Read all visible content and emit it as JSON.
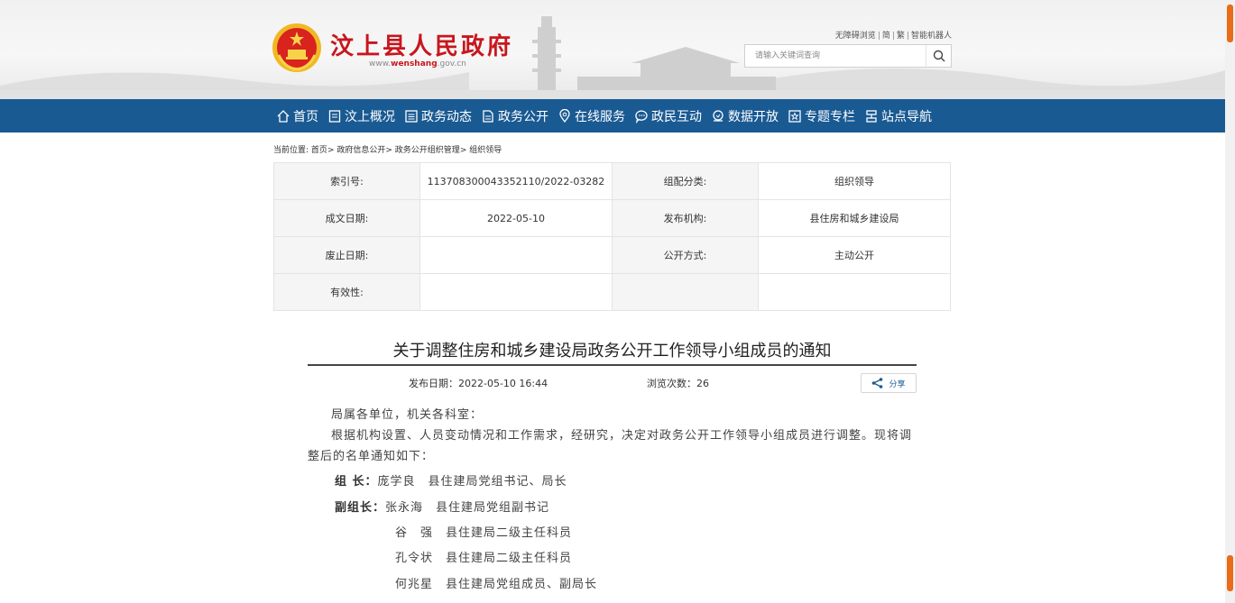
{
  "header": {
    "site_title": "汶上县人民政府",
    "url_prefix": "www.",
    "url_domain": "wenshang",
    "url_suffix": ".gov.cn",
    "top_links": [
      "无障碍浏览",
      "简",
      "繁",
      "智能机器人"
    ],
    "search_placeholder": "请输入关键词查询",
    "accent_color": "#c8161d"
  },
  "nav": {
    "bg_color": "#1a5a93",
    "items": [
      {
        "label": "首页",
        "icon": "home-icon"
      },
      {
        "label": "汶上概况",
        "icon": "document-icon"
      },
      {
        "label": "政务动态",
        "icon": "list-icon"
      },
      {
        "label": "政务公开",
        "icon": "file-icon"
      },
      {
        "label": "在线服务",
        "icon": "location-icon"
      },
      {
        "label": "政民互动",
        "icon": "chat-icon"
      },
      {
        "label": "数据开放",
        "icon": "data-icon"
      },
      {
        "label": "专题专栏",
        "icon": "topic-icon"
      },
      {
        "label": "站点导航",
        "icon": "sitemap-icon"
      }
    ]
  },
  "breadcrumb": {
    "prefix": "当前位置:",
    "items": [
      "首页",
      "政府信息公开",
      "政务公开组织管理",
      "组织领导"
    ],
    "sep": ">"
  },
  "meta": {
    "rows": [
      {
        "l1": "索引号:",
        "v1": "113708300043352110/2022-03282",
        "l2": "组配分类:",
        "v2": "组织领导"
      },
      {
        "l1": "成文日期:",
        "v1": "2022-05-10",
        "l2": "发布机构:",
        "v2": "县住房和城乡建设局"
      },
      {
        "l1": "废止日期:",
        "v1": "",
        "l2": "公开方式:",
        "v2": "主动公开"
      },
      {
        "l1": "有效性:",
        "v1": "",
        "l2": "",
        "v2": ""
      }
    ]
  },
  "article": {
    "title": "关于调整住房和城乡建设局政务公开工作领导小组成员的通知",
    "publish_date": "发布日期：2022-05-10 16:44",
    "views": "浏览次数：26",
    "share_label": "分享",
    "greeting": "局属各单位，机关各科室：",
    "paragraph": "根据机构设置、人员变动情况和工作需求，经研究，决定对政务公开工作领导小组成员进行调整。现将调整后的名单通知如下：",
    "leader_role": "组  长：",
    "leader": "庞学良　县住建局党组书记、局长",
    "deputy_role": "副组长：",
    "deputies": [
      "张永海　县住建局党组副书记",
      "谷　强　县住建局二级主任科员",
      "孔令状　县住建局二级主任科员",
      "何兆星　县住建局党组成员、副局长"
    ]
  }
}
